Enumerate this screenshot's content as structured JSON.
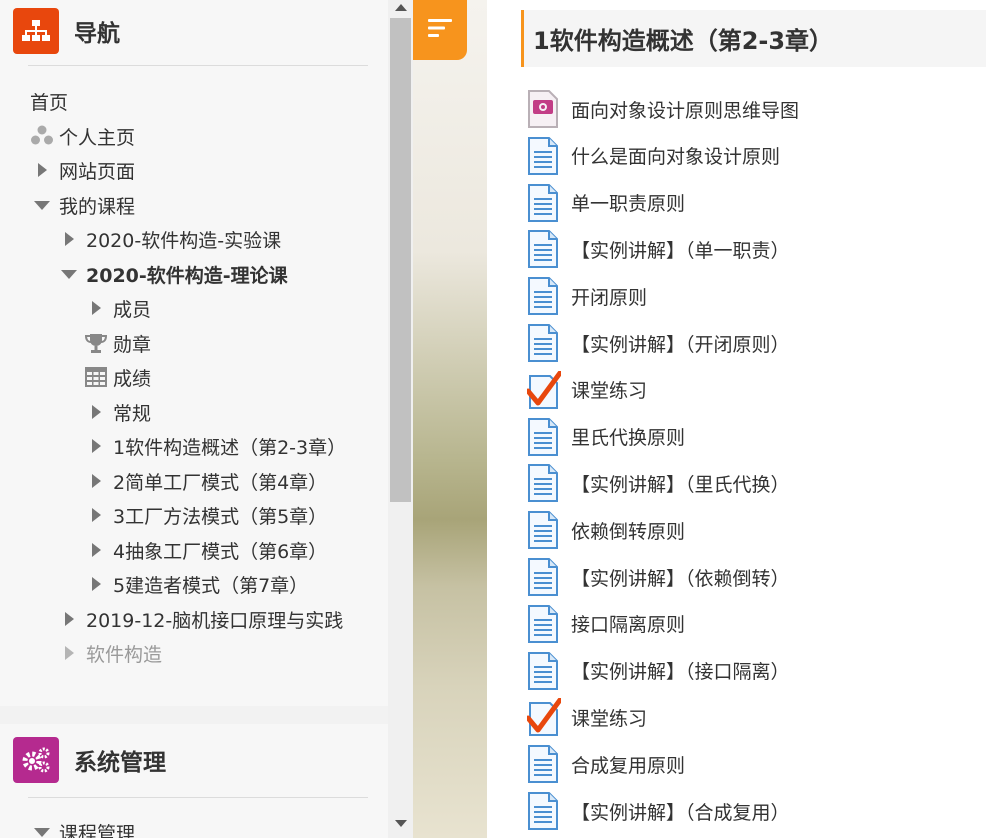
{
  "nav_block": {
    "title": "导航",
    "items": [
      {
        "label": "首页"
      },
      {
        "label": "个人主页"
      },
      {
        "label": "网站页面"
      },
      {
        "label": "我的课程"
      },
      {
        "label": "2020-软件构造-实验课"
      },
      {
        "label": "2020-软件构造-理论课"
      },
      {
        "label": "成员"
      },
      {
        "label": "勋章"
      },
      {
        "label": "成绩"
      },
      {
        "label": "常规"
      },
      {
        "label": "1软件构造概述（第2-3章）"
      },
      {
        "label": "2简单工厂模式（第4章）"
      },
      {
        "label": "3工厂方法模式（第5章）"
      },
      {
        "label": "4抽象工厂模式（第6章）"
      },
      {
        "label": "5建造者模式（第7章）"
      },
      {
        "label": "2019-12-脑机接口原理与实践"
      },
      {
        "label": "软件构造"
      }
    ]
  },
  "admin_block": {
    "title": "系统管理",
    "items": [
      {
        "label": "课程管理"
      }
    ]
  },
  "section": {
    "title": "1软件构造概述（第2-3章）",
    "activities": [
      {
        "label": "面向对象设计原则思维导图",
        "icon": "image-file-icon"
      },
      {
        "label": "什么是面向对象设计原则",
        "icon": "page-icon"
      },
      {
        "label": "单一职责原则",
        "icon": "page-icon"
      },
      {
        "label": "【实例讲解】（单一职责）",
        "icon": "page-icon"
      },
      {
        "label": "开闭原则",
        "icon": "page-icon"
      },
      {
        "label": "【实例讲解】（开闭原则）",
        "icon": "page-icon"
      },
      {
        "label": "课堂练习",
        "icon": "quiz-icon"
      },
      {
        "label": "里氏代换原则",
        "icon": "page-icon"
      },
      {
        "label": "【实例讲解】（里氏代换）",
        "icon": "page-icon"
      },
      {
        "label": "依赖倒转原则",
        "icon": "page-icon"
      },
      {
        "label": "【实例讲解】（依赖倒转）",
        "icon": "page-icon"
      },
      {
        "label": "接口隔离原则",
        "icon": "page-icon"
      },
      {
        "label": "【实例讲解】（接口隔离）",
        "icon": "page-icon"
      },
      {
        "label": "课堂练习",
        "icon": "quiz-icon"
      },
      {
        "label": "合成复用原则",
        "icon": "page-icon"
      },
      {
        "label": "【实例讲解】（合成复用）",
        "icon": "page-icon"
      }
    ]
  },
  "colors": {
    "accent": "#f7941d",
    "nav_icon_bg": "#e8470d",
    "admin_icon_bg": "#b52a8f"
  }
}
